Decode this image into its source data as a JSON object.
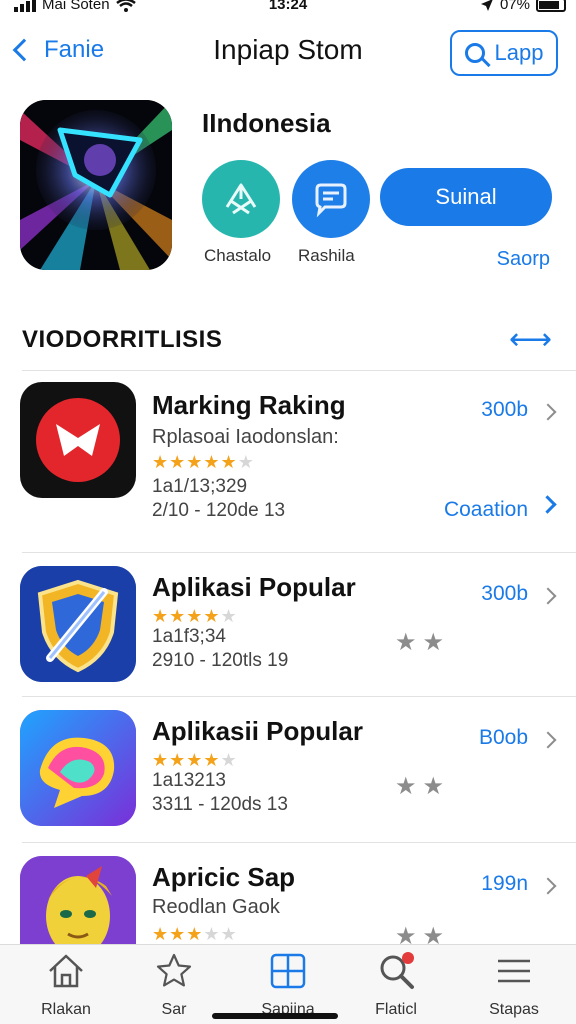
{
  "status_bar": {
    "carrier": "Mai Soten",
    "time": "13:24",
    "battery": "07%"
  },
  "nav": {
    "back_label": "Fanie",
    "title": "Inpiap Stom",
    "search_label": "Lapp"
  },
  "hero": {
    "title": "IIndonesia",
    "action1_label": "Chastalo",
    "action2_label": "Rashila",
    "primary_button": "Suinal",
    "link": "Saorp",
    "icon_name": "app-logo-icon"
  },
  "section": {
    "header": "VIODORRITLISIS"
  },
  "apps": [
    {
      "name": "Marking Raking",
      "subtitle": "Rplasoai Iaodonslan:",
      "rating": 4,
      "rating_text": "1a1/13;329",
      "meta": "2/10 - 120de 13",
      "price": "300b",
      "action": "Coaation",
      "icon_name": "play-icon"
    },
    {
      "name": "Aplikasi Popular",
      "subtitle": "",
      "rating": 4,
      "rating_text": "1a1f3;34",
      "meta": "2910 - 120tls 19",
      "price": "300b",
      "action": "",
      "icon_name": "shield-pen-icon"
    },
    {
      "name": "Aplikasii Popular",
      "subtitle": "",
      "rating": 4,
      "rating_text": "1a13213",
      "meta": "3311 - 120ds 13",
      "price": "B0ob",
      "action": "",
      "icon_name": "colorful-shape-icon"
    },
    {
      "name": "Apricic Sap",
      "subtitle": "Reodlan Gaok",
      "rating": 3,
      "rating_text": "",
      "meta": "",
      "price": "199n",
      "action": "",
      "icon_name": "character-icon"
    }
  ],
  "tabs": [
    {
      "label": "Rlakan",
      "icon": "home-icon"
    },
    {
      "label": "Sar",
      "icon": "star-icon"
    },
    {
      "label": "Sapiina",
      "icon": "apps-grid-icon"
    },
    {
      "label": "Flaticl",
      "icon": "search-icon"
    },
    {
      "label": "Stapas",
      "icon": "list-icon"
    }
  ],
  "colors": {
    "accent": "#1a7ae8",
    "teal": "#26b6ad",
    "star": "#f4a21a"
  }
}
